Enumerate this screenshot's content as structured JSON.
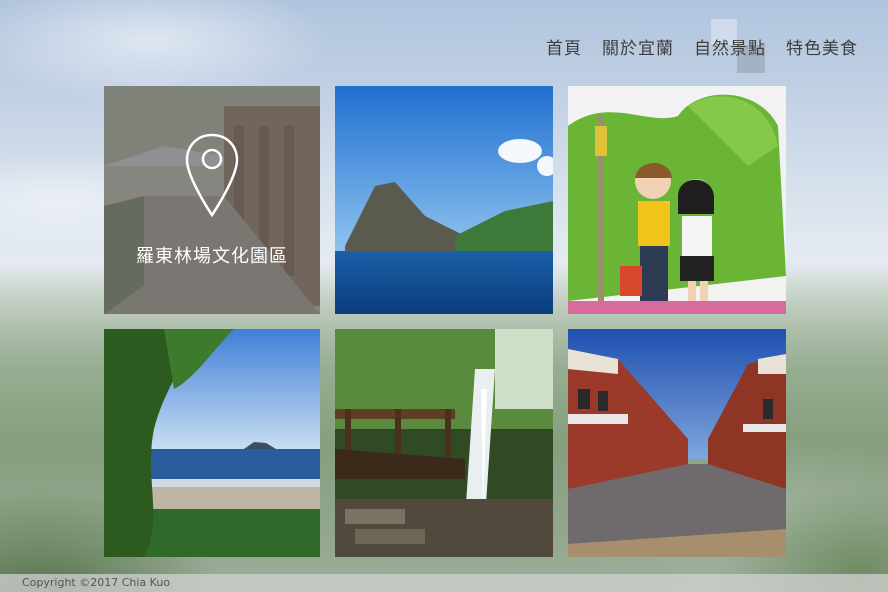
{
  "nav": {
    "items": [
      {
        "label": "首頁"
      },
      {
        "label": "關於宜蘭"
      },
      {
        "label": "自然景點"
      },
      {
        "label": "特色美食"
      }
    ]
  },
  "gallery": {
    "tiles": [
      {
        "caption": "羅東林場文化園區",
        "icon": "map-pin-icon",
        "scene": "wooden-boardwalk-forest-park"
      },
      {
        "scene": "turtle-island-sea-rock"
      },
      {
        "scene": "cartoon-statue-children-green-tree"
      },
      {
        "scene": "coastal-view-with-island"
      },
      {
        "scene": "waterfall-with-wooden-bridge"
      },
      {
        "scene": "red-brick-old-street"
      }
    ]
  },
  "footer": {
    "copyright": "Copyright ©2017 Chia Kuo"
  },
  "colors": {
    "nav_text": "#3e3e3e",
    "overlay": "#5f5f5f",
    "footer_bg": "#d2d2d2"
  }
}
